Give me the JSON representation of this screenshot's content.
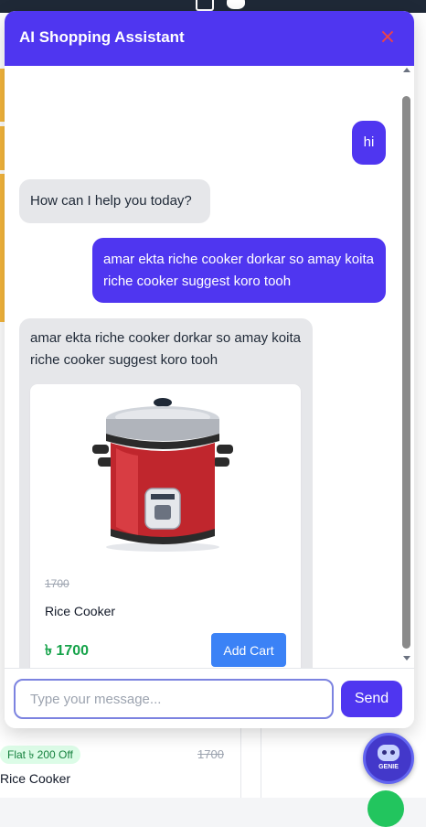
{
  "background": {
    "discount_badge": "Flat ৳ 200 Off",
    "old_price": "1700",
    "product_name": "Rice Cooker",
    "genie_label": "GENIE"
  },
  "chat": {
    "title": "AI Shopping Assistant",
    "close_icon": "×",
    "messages": [
      {
        "role": "user",
        "text": "hi"
      },
      {
        "role": "bot",
        "text": "How can I help you today?"
      },
      {
        "role": "user",
        "text": "amar ekta riche cooker dorkar so amay koita riche cooker suggest koro tooh"
      },
      {
        "role": "bot",
        "text": "amar ekta riche cooker dorkar so amay koita riche cooker suggest koro tooh",
        "product": {
          "image_icon": "rice-cooker-image",
          "old_price": "1700",
          "name": "Rice Cooker",
          "price": "৳ 1700",
          "add_cart_label": "Add Cart"
        }
      }
    ],
    "input": {
      "value": "",
      "placeholder": "Type your message..."
    },
    "send_label": "Send"
  },
  "colors": {
    "accent": "#4f36f0",
    "close": "#ef4444",
    "price": "#16a34a",
    "add_cart": "#3b82f6",
    "bot_bubble": "#e6e7ea"
  }
}
